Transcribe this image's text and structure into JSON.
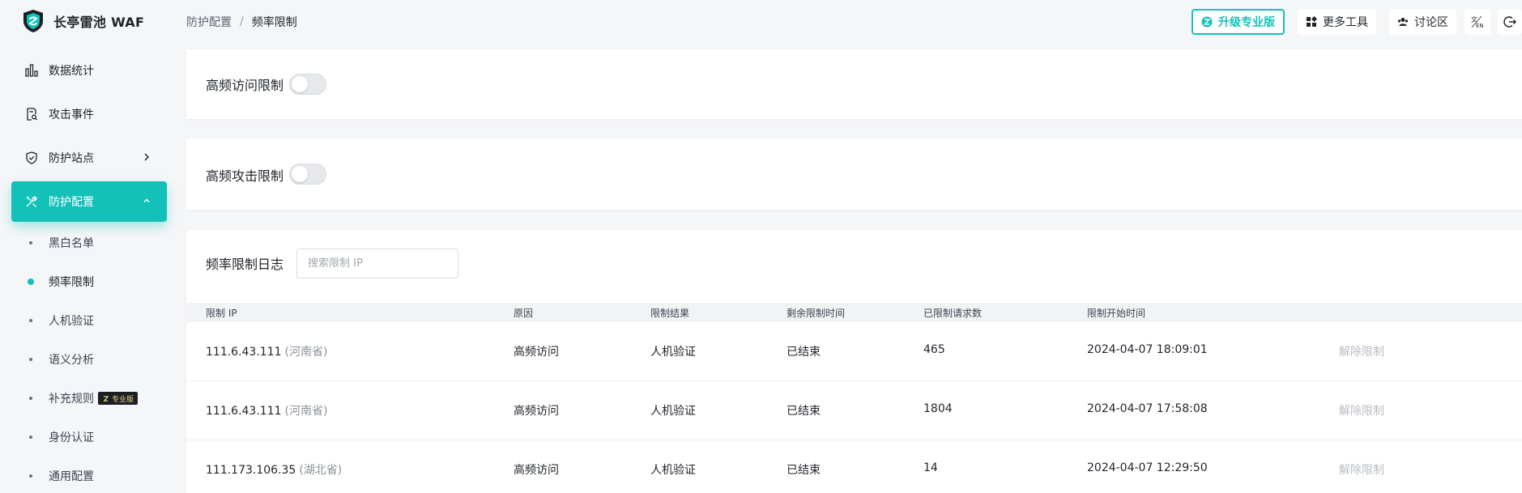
{
  "app": {
    "title": "长亭雷池 WAF"
  },
  "breadcrumb": {
    "parent": "防护配置",
    "separator": "/",
    "current": "频率限制"
  },
  "header": {
    "upgrade_label": "升级专业版",
    "tools_label": "更多工具",
    "forum_label": "讨论区",
    "accent": "#14c1b8"
  },
  "sidebar": {
    "items": [
      {
        "label": "数据统计",
        "icon": "bar-chart-icon"
      },
      {
        "label": "攻击事件",
        "icon": "document-search-icon"
      },
      {
        "label": "防护站点",
        "icon": "shield-icon"
      },
      {
        "label": "防护配置",
        "icon": "tools-icon"
      }
    ],
    "subitems": [
      {
        "label": "黑白名单"
      },
      {
        "label": "频率限制"
      },
      {
        "label": "人机验证"
      },
      {
        "label": "语义分析"
      },
      {
        "label": "补充规则",
        "badge": "专业版"
      },
      {
        "label": "身份认证"
      },
      {
        "label": "通用配置"
      }
    ]
  },
  "high_freq_access": {
    "label": "高频访问限制",
    "enabled": false
  },
  "high_freq_attack": {
    "label": "高频攻击限制",
    "enabled": false
  },
  "log": {
    "title": "频率限制日志",
    "search_placeholder": "搜索限制 IP",
    "columns": [
      "限制 IP",
      "原因",
      "限制结果",
      "剩余限制时间",
      "已限制请求数",
      "限制开始时间"
    ],
    "rows": [
      {
        "ip": "111.6.43.111",
        "region": "(河南省)",
        "reason": "高频访问",
        "result": "人机验证",
        "remaining": "已结束",
        "count": "465",
        "start": "2024-04-07 18:09:01",
        "action": "解除限制"
      },
      {
        "ip": "111.6.43.111",
        "region": "(河南省)",
        "reason": "高频访问",
        "result": "人机验证",
        "remaining": "已结束",
        "count": "1804",
        "start": "2024-04-07 17:58:08",
        "action": "解除限制"
      },
      {
        "ip": "111.173.106.35",
        "region": "(湖北省)",
        "reason": "高频访问",
        "result": "人机验证",
        "remaining": "已结束",
        "count": "14",
        "start": "2024-04-07 12:29:50",
        "action": "解除限制"
      }
    ]
  }
}
